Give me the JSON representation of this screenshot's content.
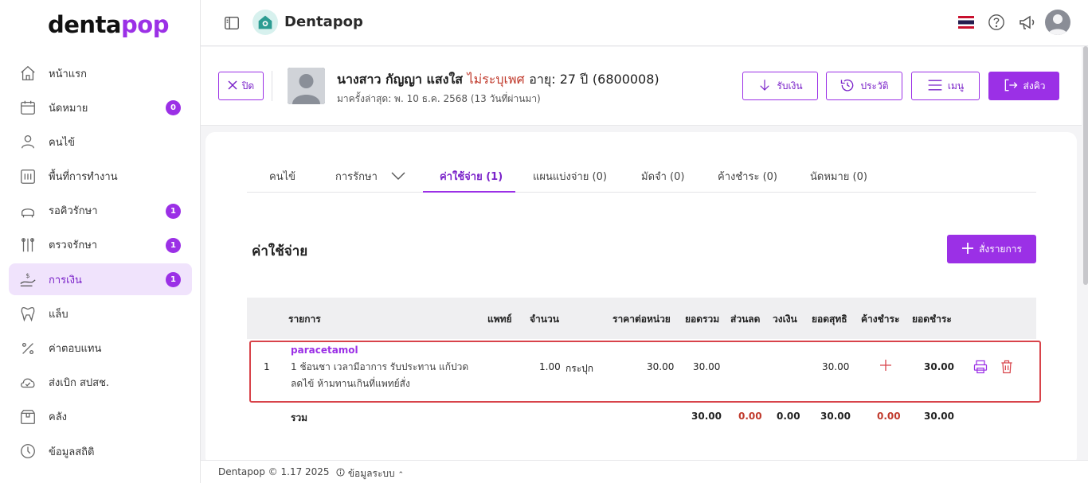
{
  "brand": {
    "logo_main": "denta",
    "logo_accent": "pop",
    "app_title": "Dentapop"
  },
  "sidebar": {
    "items": [
      {
        "label": "หน้าแรก",
        "icon": "home-icon",
        "badge": ""
      },
      {
        "label": "นัดหมาย",
        "icon": "calendar-icon",
        "badge": "0"
      },
      {
        "label": "คนไข้",
        "icon": "user-icon",
        "badge": ""
      },
      {
        "label": "พื้นที่การทำงาน",
        "icon": "workspace-icon",
        "badge": ""
      },
      {
        "label": "รอคิวรักษา",
        "icon": "dental-chair-icon",
        "badge": "1"
      },
      {
        "label": "ตรวจรักษา",
        "icon": "dental-tools-icon",
        "badge": "1"
      },
      {
        "label": "การเงิน",
        "icon": "money-hand-icon",
        "badge": "1"
      },
      {
        "label": "แล็บ",
        "icon": "tooth-icon",
        "badge": ""
      },
      {
        "label": "ค่าตอบแทน",
        "icon": "percent-icon",
        "badge": ""
      },
      {
        "label": "ส่งเบิก สปสช.",
        "icon": "cloud-check-icon",
        "badge": ""
      },
      {
        "label": "คลัง",
        "icon": "box-icon",
        "badge": ""
      },
      {
        "label": "ข้อมูลสถิติ",
        "icon": "chart-icon",
        "badge": ""
      }
    ],
    "active_index": 6
  },
  "patient": {
    "close_label": "ปิด",
    "name": "นางสาว กัญญา แสงใส",
    "sex": "ไม่ระบุเพศ",
    "age": "อายุ: 27 ปี",
    "hn": "(6800008)",
    "last_visit": "มาครั้งล่าสุด: พ. 10 ธ.ค. 2568 (13 วันที่ผ่านมา)",
    "actions": {
      "receive": "รับเงิน",
      "history": "ประวัติ",
      "menu": "เมนู",
      "send_queue": "ส่งคิว"
    }
  },
  "tabs": [
    {
      "label": "คนไข้"
    },
    {
      "label": "การรักษา"
    },
    {
      "label": "ค่าใช้จ่าย (1)"
    },
    {
      "label": "แผนแบ่งจ่าย (0)"
    },
    {
      "label": "มัดจำ (0)"
    },
    {
      "label": "ค้างชำระ (0)"
    },
    {
      "label": "นัดหมาย (0)"
    }
  ],
  "section": {
    "title": "ค่าใช้จ่าย",
    "add_label": "สั่งรายการ"
  },
  "table": {
    "headers": {
      "item": "รายการ",
      "doctor": "แพทย์",
      "qty": "จำนวน",
      "unit_price": "ราคาต่อหน่วย",
      "total": "ยอดรวม",
      "discount": "ส่วนลด",
      "credit": "วงเงิน",
      "net": "ยอดสุทธิ",
      "outstanding": "ค้างชำระ",
      "pay": "ยอดชำระ"
    },
    "rows": [
      {
        "no": "1",
        "name": "paracetamol",
        "desc": "1 ช้อนชา เวลามีอาการ รับประทาน แก้ปวด ลดไข้ ห้ามทานเกินที่แพทย์สั่ง",
        "qty": "1.00",
        "unit": "กระปุก",
        "unit_price": "30.00",
        "total": "30.00",
        "net": "30.00",
        "pay": "30.00"
      }
    ],
    "summary": {
      "label": "รวม",
      "total": "30.00",
      "discount": "0.00",
      "credit": "0.00",
      "net": "30.00",
      "outstanding": "0.00",
      "pay": "30.00"
    }
  },
  "footer": {
    "copyright": "Dentapop © 1.17 2025",
    "sysinfo": "ข้อมูลระบบ"
  },
  "colors": {
    "accent": "#9b30e6",
    "danger": "#d8434a"
  }
}
